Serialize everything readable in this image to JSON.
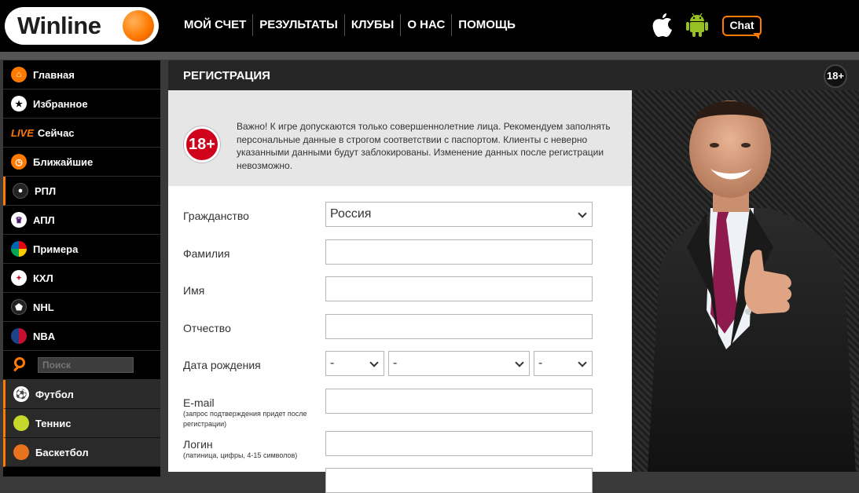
{
  "brand": {
    "name": "Winline",
    "accent": "#ff7a00"
  },
  "nav": {
    "items": [
      "МОЙ СЧЕТ",
      "РЕЗУЛЬТАТЫ",
      "КЛУБЫ",
      "О НАС",
      "ПОМОЩЬ"
    ]
  },
  "header_icons": {
    "apple": "apple-icon",
    "android": "android-icon",
    "chat_label": "Chat"
  },
  "sidebar": {
    "items": [
      {
        "label": "Главная",
        "icon": "home-icon"
      },
      {
        "label": "Избранное",
        "icon": "star-icon"
      },
      {
        "live": "LIVE",
        "label": "Сейчас"
      },
      {
        "label": "Ближайшие",
        "icon": "clock-icon"
      },
      {
        "label": "РПЛ",
        "icon": "rpl-logo-icon"
      },
      {
        "label": "АПЛ",
        "icon": "epl-logo-icon"
      },
      {
        "label": "Примера",
        "icon": "laliga-logo-icon"
      },
      {
        "label": "КХЛ",
        "icon": "khl-logo-icon"
      },
      {
        "label": "NHL",
        "icon": "nhl-logo-icon"
      },
      {
        "label": "NBA",
        "icon": "nba-logo-icon"
      }
    ],
    "search_placeholder": "Поиск",
    "sports": [
      {
        "label": "Футбол",
        "icon": "football-icon"
      },
      {
        "label": "Теннис",
        "icon": "tennis-icon"
      },
      {
        "label": "Баскетбол",
        "icon": "basketball-icon"
      }
    ]
  },
  "registration": {
    "title": "РЕГИСТРАЦИЯ",
    "age_badge": "18+",
    "warning_badge": "18+",
    "warning_text": "Важно! К игре допускаются только совершеннолетние лица. Рекомендуем заполнять персональные данные в строгом соответствии с паспортом. Клиенты с неверно указанными данными будут заблокированы. Изменение данных после регистрации невозможно.",
    "fields": {
      "citizenship_label": "Гражданство",
      "citizenship_value": "Россия",
      "surname_label": "Фамилия",
      "name_label": "Имя",
      "patronymic_label": "Отчество",
      "birthdate_label": "Дата рождения",
      "birth_day": "-",
      "birth_month": "-",
      "birth_year": "-",
      "email_label": "E-mail",
      "email_hint": "(запрос подтверждения придет после регистрации)",
      "login_label": "Логин",
      "login_hint": "(латиница, цифры, 4-15 символов)"
    }
  }
}
